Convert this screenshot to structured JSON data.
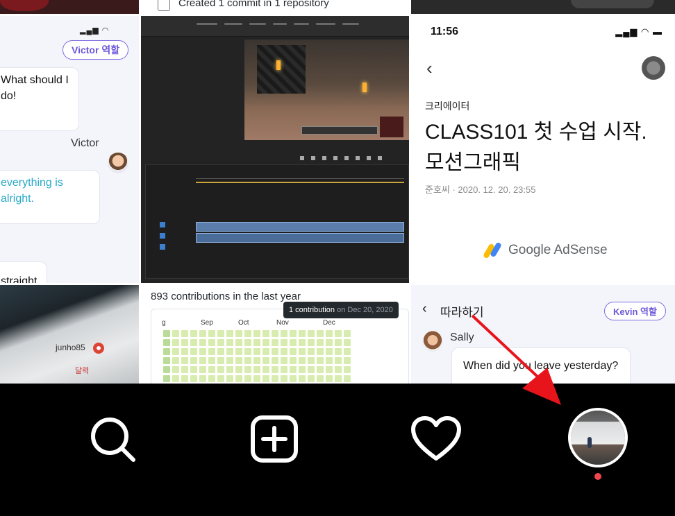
{
  "colors": {
    "accent_purple": "#6b58d8",
    "link_cyan": "#29a8c8",
    "annotation_red": "#e8141c",
    "notification_dot": "#f0474f",
    "tabbar_bg": "#000000"
  },
  "feed": {
    "repo_activity": "Created 1 commit in 1 repository",
    "chat_tile": {
      "role_pill": "Victor 역할",
      "bubble1": "What should I do!",
      "sender": "Victor",
      "bubble2": "everything is alright.",
      "bubble3": "straight."
    },
    "article_tile": {
      "time": "11:56",
      "category": "크리에이터",
      "title": "CLASS101 첫 수업 시작. 모션그래픽",
      "meta": "준호씨 · 2020. 12. 20. 23:55",
      "ads_brand": "Google AdSense"
    },
    "photo_tile": {
      "username": "junho85",
      "label": "달력"
    },
    "contrib_tile": {
      "headline": "893 contributions in the last year",
      "months": [
        "g",
        "Sep",
        "Oct",
        "Nov",
        "Dec"
      ],
      "tooltip_count": "1 contribution",
      "tooltip_date": "on Dec 20, 2020"
    },
    "chat2_tile": {
      "title": "따라하기",
      "role_pill": "Kevin 역할",
      "sender": "Sally",
      "bubble": "When did you leave yesterday?"
    }
  },
  "tabbar": {
    "items": [
      {
        "name": "search",
        "icon": "search-icon"
      },
      {
        "name": "add",
        "icon": "plus-square-icon"
      },
      {
        "name": "activity",
        "icon": "heart-icon"
      },
      {
        "name": "profile",
        "icon": "avatar"
      }
    ]
  }
}
